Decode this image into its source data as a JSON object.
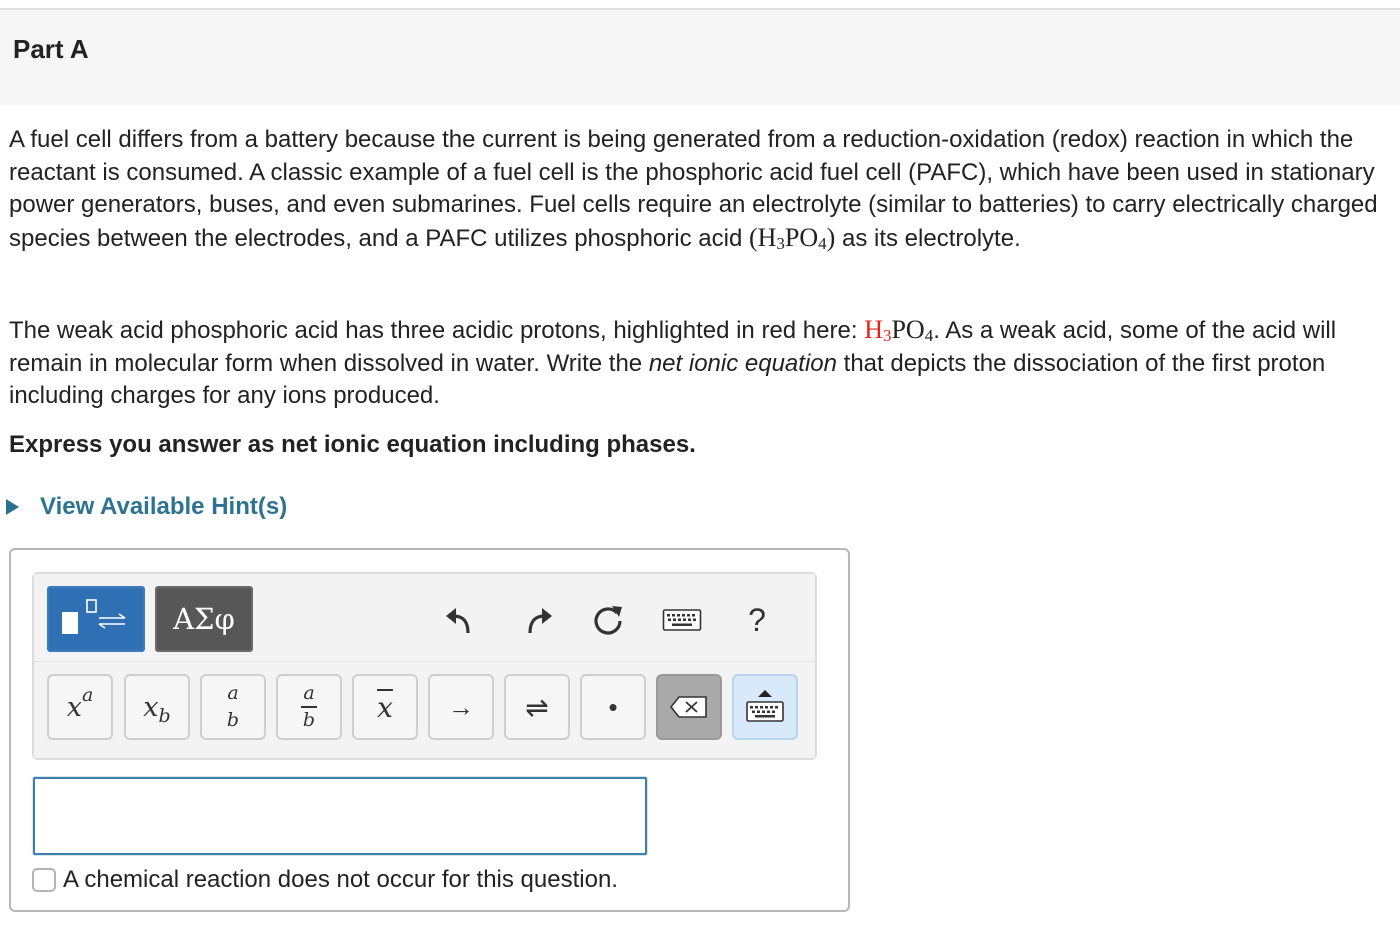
{
  "part": {
    "title": "Part A"
  },
  "question": {
    "p1_a": "A fuel cell differs from a battery because the current is being generated from a reduction-oxidation (redox) reaction in which the reactant is consumed. A classic example of a fuel cell is the phosphoric acid fuel cell (PAFC), which have been used in stationary power generators, buses, and even submarines. Fuel cells require an electrolyte (similar to batteries) to carry electrically charged species between the electrodes, and a PAFC utilizes phosphoric acid ",
    "p1_formula_open": "(H",
    "p1_formula_sub3": "3",
    "p1_formula_po": "PO",
    "p1_formula_sub4": "4",
    "p1_formula_close": ")",
    "p1_b": " as its electrolyte.",
    "p2_a": "The weak acid phosphoric acid has three acidic protons, highlighted in red here: ",
    "p2_formula_h": "H",
    "p2_formula_sub3": "3",
    "p2_formula_po": "PO",
    "p2_formula_sub4": "4",
    "p2_b": ". As a weak acid, some of the acid will remain in molecular form when dissolved in water.  Write the ",
    "p2_italic": "net ionic equation",
    "p2_c": " that depicts the dissociation of the first proton including charges for any ions produced.",
    "instruction": "Express you answer as net ionic equation including phases."
  },
  "hint": {
    "label": "View Available Hint(s)"
  },
  "toolbar": {
    "modes": [
      {
        "name": "templates",
        "icon": "templates-icon",
        "selected": true
      },
      {
        "name": "symbols",
        "label": "ΑΣφ",
        "selected": false
      }
    ],
    "actions": [
      {
        "icon": "undo-icon"
      },
      {
        "icon": "redo-icon"
      },
      {
        "icon": "reset-icon"
      },
      {
        "icon": "keyboard-shortcuts-icon"
      },
      {
        "icon": "help-icon",
        "label": "?"
      }
    ],
    "keys": [
      {
        "icon": "superscript-icon",
        "base": "x",
        "sup": "a"
      },
      {
        "icon": "subscript-icon",
        "base": "x",
        "sub": "b"
      },
      {
        "icon": "stack-icon",
        "top": "a",
        "bottom": "b"
      },
      {
        "icon": "fraction-icon",
        "top": "a",
        "bottom": "b"
      },
      {
        "icon": "overline-icon",
        "base": "x"
      },
      {
        "icon": "reaction-arrow-icon",
        "label": "→"
      },
      {
        "icon": "equilibrium-arrow-icon",
        "label": "⇌"
      },
      {
        "icon": "dot-icon",
        "label": "•"
      },
      {
        "icon": "backspace-icon"
      },
      {
        "icon": "keyboard-toggle-icon"
      }
    ]
  },
  "answer": {
    "value": ""
  },
  "no_reaction": {
    "label": "A chemical reaction does not occur for this question.",
    "checked": false
  },
  "colors": {
    "link": "#2e7391",
    "highlight_red": "#e0221b",
    "mode_selected": "#2f6fb4",
    "mode_dark": "#575757",
    "input_border": "#3f7fa7"
  }
}
